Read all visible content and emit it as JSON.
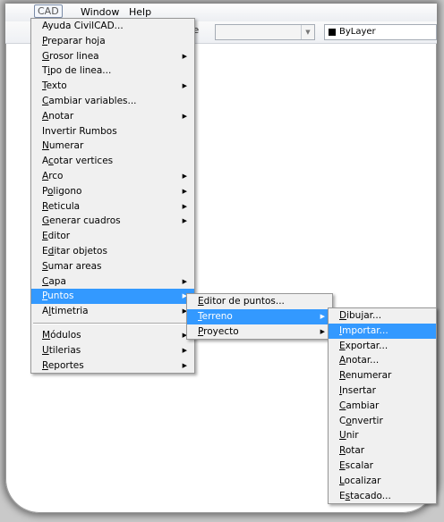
{
  "menubar": {
    "cad_label": "CAD",
    "window_label": "Window",
    "help_label": "Help"
  },
  "toolbar": {
    "button_glyph": "Be",
    "layer_label": "ByLayer"
  },
  "main_menu": {
    "items": [
      {
        "pre": "",
        "acc": "",
        "post": "Ayuda CivilCAD...",
        "sub": false
      },
      {
        "pre": "",
        "acc": "P",
        "post": "reparar hoja",
        "sub": false
      },
      {
        "pre": "",
        "acc": "G",
        "post": "rosor linea",
        "sub": true
      },
      {
        "pre": "T",
        "acc": "i",
        "post": "po de linea...",
        "sub": false
      },
      {
        "pre": "",
        "acc": "T",
        "post": "exto",
        "sub": true
      },
      {
        "pre": "",
        "acc": "C",
        "post": "ambiar variables...",
        "sub": false
      },
      {
        "pre": "",
        "acc": "A",
        "post": "notar",
        "sub": true
      },
      {
        "pre": "",
        "acc": "",
        "post": "Invertir Rumbos",
        "sub": false
      },
      {
        "pre": "",
        "acc": "N",
        "post": "umerar",
        "sub": false
      },
      {
        "pre": "A",
        "acc": "c",
        "post": "otar vertices",
        "sub": false
      },
      {
        "pre": "",
        "acc": "A",
        "post": "rco",
        "sub": true
      },
      {
        "pre": "P",
        "acc": "o",
        "post": "ligono",
        "sub": true
      },
      {
        "pre": "",
        "acc": "R",
        "post": "eticula",
        "sub": true
      },
      {
        "pre": "",
        "acc": "G",
        "post": "enerar cuadros",
        "sub": true
      },
      {
        "pre": "",
        "acc": "E",
        "post": "ditor",
        "sub": false
      },
      {
        "pre": "E",
        "acc": "d",
        "post": "itar objetos",
        "sub": false
      },
      {
        "pre": "",
        "acc": "S",
        "post": "umar areas",
        "sub": false
      },
      {
        "pre": "",
        "acc": "C",
        "post": "apa",
        "sub": true
      },
      {
        "pre": "",
        "acc": "P",
        "post": "untos",
        "sub": true,
        "active": true
      },
      {
        "pre": "A",
        "acc": "l",
        "post": "timetria",
        "sub": true
      },
      {
        "sep": true
      },
      {
        "pre": "",
        "acc": "M",
        "post": "ódulos",
        "sub": true
      },
      {
        "pre": "",
        "acc": "U",
        "post": "tilerias",
        "sub": true
      },
      {
        "pre": "",
        "acc": "R",
        "post": "eportes",
        "sub": true
      }
    ]
  },
  "puntos_menu": {
    "items": [
      {
        "pre": "",
        "acc": "E",
        "post": "ditor de puntos...",
        "sub": false
      },
      {
        "pre": "",
        "acc": "T",
        "post": "erreno",
        "sub": true,
        "active": true
      },
      {
        "pre": "",
        "acc": "P",
        "post": "royecto",
        "sub": true
      }
    ]
  },
  "terreno_menu": {
    "items": [
      {
        "pre": "",
        "acc": "D",
        "post": "ibujar...",
        "sub": false
      },
      {
        "pre": "",
        "acc": "I",
        "post": "mportar...",
        "sub": false,
        "active": true
      },
      {
        "pre": "",
        "acc": "E",
        "post": "xportar...",
        "sub": false
      },
      {
        "pre": "",
        "acc": "A",
        "post": "notar...",
        "sub": false
      },
      {
        "pre": "",
        "acc": "R",
        "post": "enumerar",
        "sub": false
      },
      {
        "pre": "",
        "acc": "I",
        "post": "nsertar",
        "sub": false
      },
      {
        "pre": "",
        "acc": "C",
        "post": "ambiar",
        "sub": false
      },
      {
        "pre": "C",
        "acc": "o",
        "post": "nvertir",
        "sub": false
      },
      {
        "pre": "",
        "acc": "U",
        "post": "nir",
        "sub": false
      },
      {
        "pre": "",
        "acc": "R",
        "post": "otar",
        "sub": false
      },
      {
        "pre": "",
        "acc": "E",
        "post": "scalar",
        "sub": false
      },
      {
        "pre": "",
        "acc": "L",
        "post": "ocalizar",
        "sub": false
      },
      {
        "pre": "E",
        "acc": "s",
        "post": "tacado...",
        "sub": false
      }
    ]
  }
}
